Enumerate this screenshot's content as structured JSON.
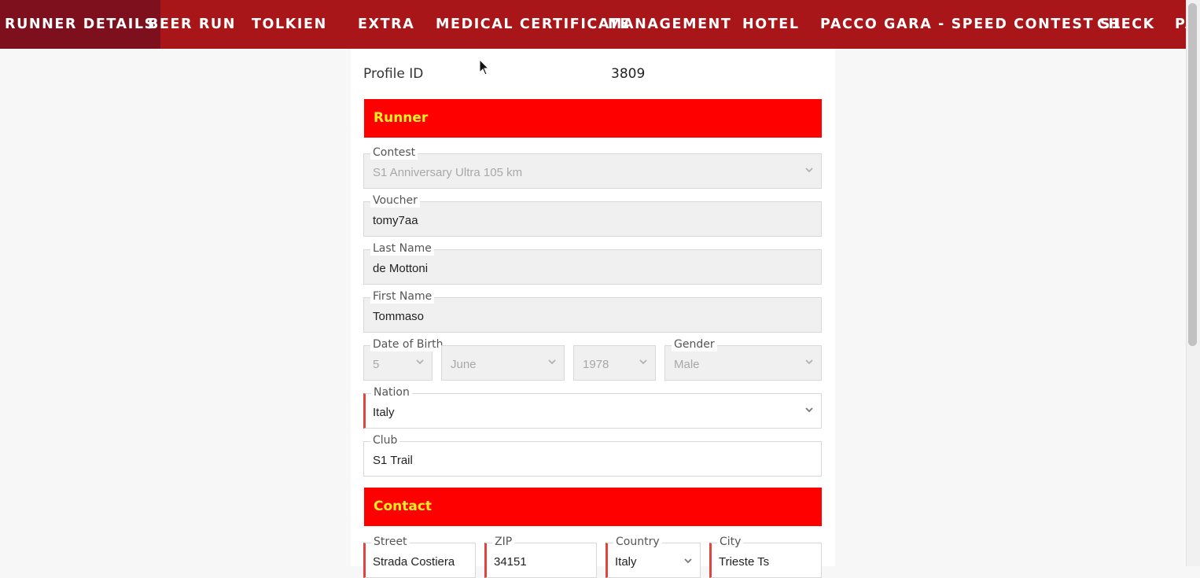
{
  "nav": {
    "items": [
      {
        "label": "RUNNER DETAILS",
        "active": true
      },
      {
        "label": "BEER RUN"
      },
      {
        "label": "TOLKIEN"
      },
      {
        "label": "EXTRA"
      },
      {
        "label": "MEDICAL CERTIFICATE"
      },
      {
        "label": "MANAGEMENT"
      },
      {
        "label": "HOTEL"
      },
      {
        "label": "PACCO GARA - SPEED CONTEST S1"
      },
      {
        "label": "CHECK"
      },
      {
        "label": "PA"
      }
    ]
  },
  "profile": {
    "label": "Profile ID",
    "value": "3809"
  },
  "sections": {
    "runner": "Runner",
    "contact": "Contact"
  },
  "form": {
    "contest": {
      "label": "Contest",
      "value": "S1 Anniversary Ultra 105 km"
    },
    "voucher": {
      "label": "Voucher",
      "value": "tomy7aa"
    },
    "last_name": {
      "label": "Last Name",
      "value": "de Mottoni"
    },
    "first_name": {
      "label": "First Name",
      "value": "Tommaso"
    },
    "dob": {
      "label": "Date of Birth",
      "day": "5",
      "month": "June",
      "year": "1978"
    },
    "gender": {
      "label": "Gender",
      "value": "Male"
    },
    "nation": {
      "label": "Nation",
      "value": "Italy"
    },
    "club": {
      "label": "Club",
      "value": "S1 Trail"
    },
    "street": {
      "label": "Street",
      "value": "Strada Costiera"
    },
    "zip": {
      "label": "ZIP",
      "value": "34151"
    },
    "country": {
      "label": "Country",
      "value": "Italy"
    },
    "city": {
      "label": "City",
      "value": "Trieste Ts"
    }
  },
  "icons": {
    "dropdown": "chevron-down-icon",
    "cursor": "mouse-pointer-icon"
  },
  "colors": {
    "nav_bg": "#a8161a",
    "nav_active_bg": "#7e0f1c",
    "section_bg": "#ff0000",
    "section_text": "#ffee22",
    "required_marker": "#e0443c"
  }
}
